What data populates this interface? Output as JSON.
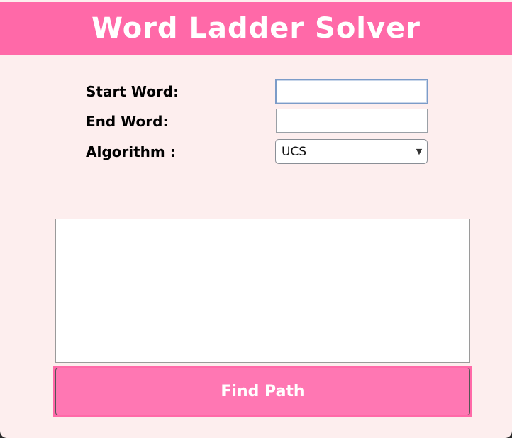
{
  "app": {
    "title": "Word Ladder Solver"
  },
  "form": {
    "start_word_label": "Start Word:",
    "start_word_value": "",
    "end_word_label": "End Word:",
    "end_word_value": "",
    "algorithm_label": "Algorithm :",
    "algorithm_selected": "UCS"
  },
  "output": {
    "text": ""
  },
  "actions": {
    "find_path_label": "Find Path"
  },
  "colors": {
    "header": "#ff69a8",
    "background": "#fdeeee",
    "button": "#ff77b3"
  }
}
